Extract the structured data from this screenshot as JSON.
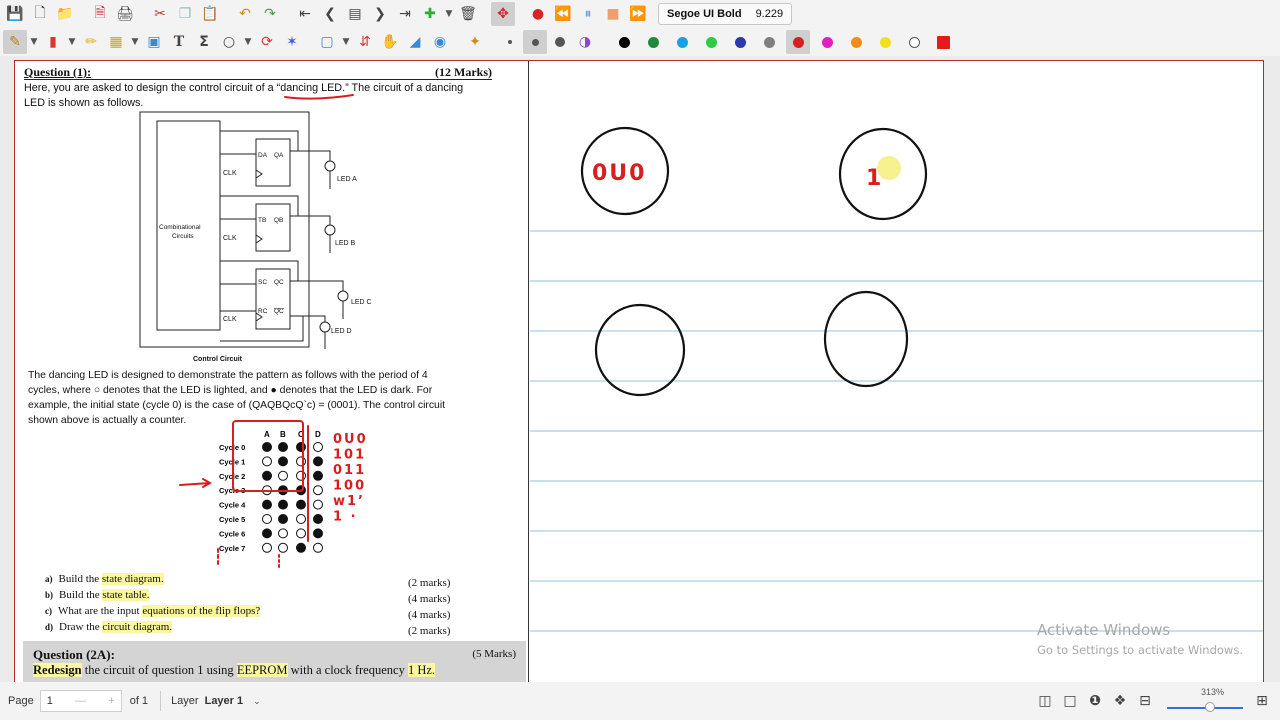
{
  "font": {
    "name": "Segoe UI Bold",
    "size": "9.229"
  },
  "colors": [
    "#000000",
    "#1f8a3a",
    "#1aa3e0",
    "#2ecc40",
    "#2a3aa8",
    "#808080",
    "#d61f1f",
    "#e020c0",
    "#f28c1e",
    "#f0e020",
    "#ffffff",
    "#e51b1b"
  ],
  "question1": {
    "title": "Question (1):",
    "marks": "(12 Marks)",
    "intro_a": "Here, you are asked to design the control circuit of a ",
    "intro_q": "“dancing LED.”",
    "intro_b": " The circuit of a dancing",
    "intro_c": "LED is shown as follows.",
    "p1": "The dancing LED is designed to demonstrate the pattern as follows with the period of 4",
    "p2": "cycles, where ○ denotes that the LED is lighted, and ● denotes that the LED is dark. For",
    "p3": "example, the initial state (cycle 0) is the case of (QAQBQcQ`c) = (0001). The control circuit",
    "p4": "shown above is actually a counter."
  },
  "circuit": {
    "comb1": "Combinational",
    "comb2": "Circuits",
    "caption": "Control Circuit",
    "clk": "CLK",
    "da": "DA",
    "qa": "QA",
    "tb": "TB",
    "qb": "QB",
    "sc": "SC",
    "rc": "RC",
    "qc": "QC",
    "qcb": "QC",
    "led_a": "LED A",
    "led_b": "LED B",
    "led_c": "LED C",
    "led_d": "LED D"
  },
  "table": {
    "columns": [
      "A",
      "B",
      "C",
      "D"
    ],
    "rows": [
      "Cycle 0",
      "Cycle 1",
      "Cycle 2",
      "Cycle 3",
      "Cycle 4",
      "Cycle 5",
      "Cycle 6",
      "Cycle 7"
    ],
    "states": [
      [
        1,
        1,
        1,
        0
      ],
      [
        0,
        1,
        0,
        1
      ],
      [
        1,
        0,
        0,
        1
      ],
      [
        0,
        1,
        1,
        0
      ],
      [
        1,
        1,
        1,
        0
      ],
      [
        0,
        1,
        0,
        1
      ],
      [
        1,
        0,
        0,
        1
      ],
      [
        0,
        0,
        1,
        0
      ]
    ]
  },
  "handwriting": [
    "0U0",
    "101",
    "011",
    "100",
    "w1’",
    "1 ·"
  ],
  "subquestions": [
    {
      "letter": "a)",
      "pre": "Build the ",
      "hl": "state diagram.",
      "marks": "(2 marks)"
    },
    {
      "letter": "b)",
      "pre": "Build the ",
      "hl": "state table.",
      "marks": "(4 marks)"
    },
    {
      "letter": "c)",
      "pre": "What are the input ",
      "hl": "equations of the flip flops?",
      "marks": "(4 marks)"
    },
    {
      "letter": "d)",
      "pre": "Draw the ",
      "hl": "circuit diagram.",
      "marks": "(2 marks)"
    }
  ],
  "question2a": {
    "title": "Question (2A):",
    "marks": "(5 Marks)",
    "text_hl1": "Redesign",
    "text_mid": " the circuit of question 1 using ",
    "text_hl2": "EEPROM",
    "text_end": " with a clock frequency ",
    "text_hl3": "1 Hz."
  },
  "notes": {
    "circle1_text": "0U0",
    "circle2_text": "1"
  },
  "watermark": {
    "line1": "Activate Windows",
    "line2": "Go to Settings to activate Windows."
  },
  "status": {
    "page_label": "Page",
    "page_value": "1",
    "page_of": "of 1",
    "layer_label": "Layer",
    "layer_value": "Layer 1",
    "zoom": "313%"
  }
}
